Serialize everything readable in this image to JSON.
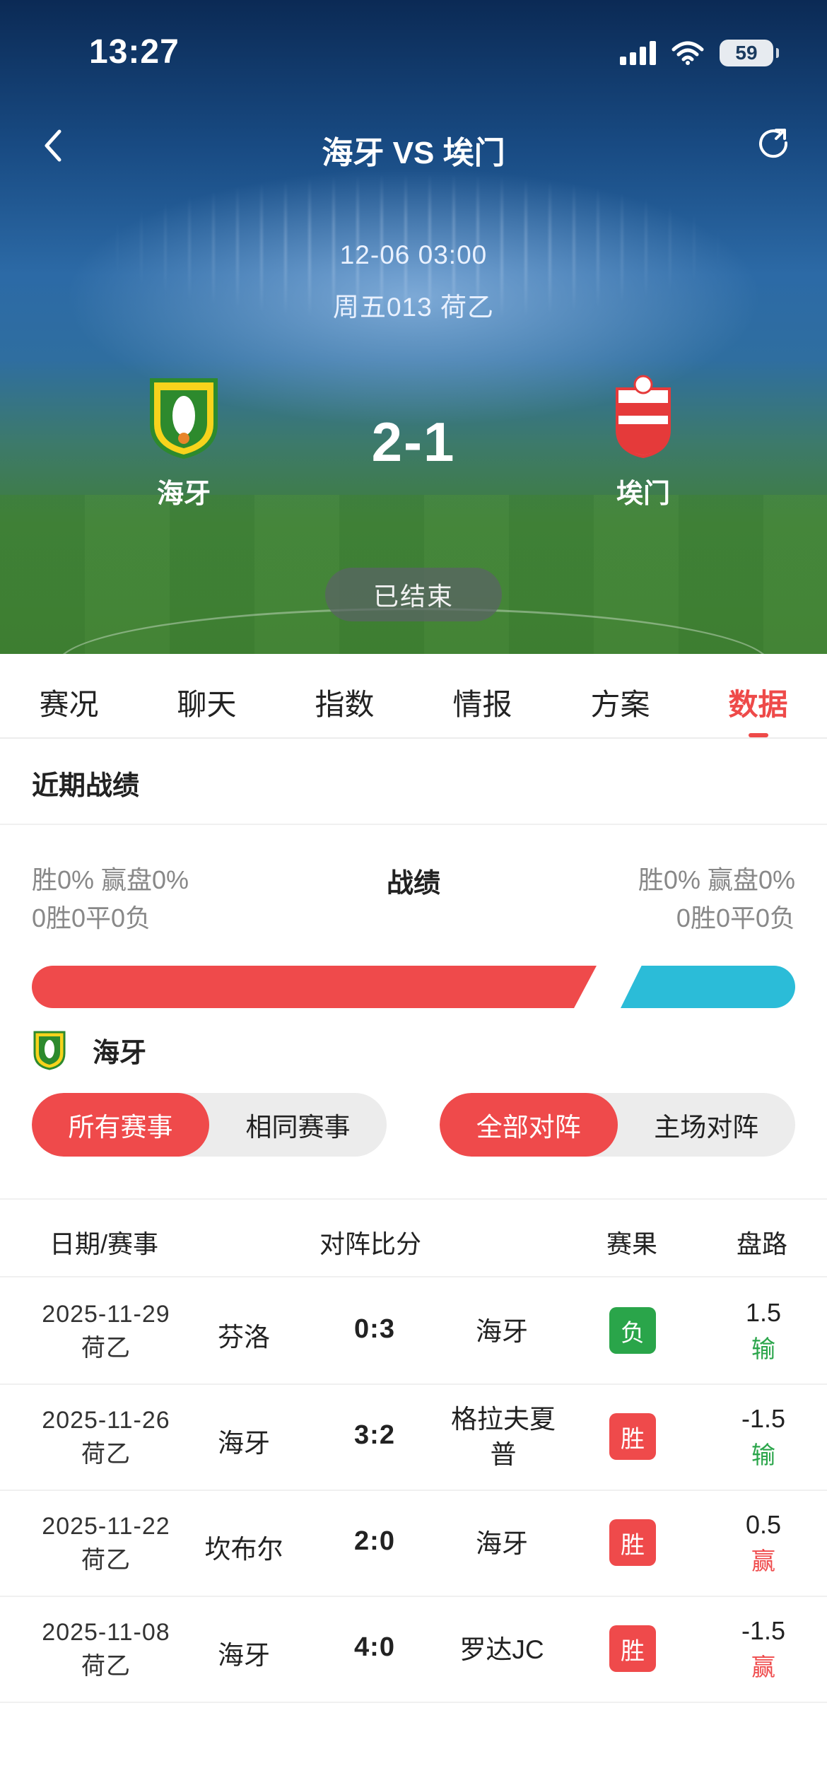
{
  "status": {
    "time": "13:27",
    "battery": "59"
  },
  "nav": {
    "title": "海牙 VS 埃门"
  },
  "match": {
    "datetime": "12-06 03:00",
    "league_line": "周五013 荷乙",
    "home_team": "海牙",
    "away_team": "埃门",
    "score": "2-1",
    "state": "已结束"
  },
  "tabs": [
    "赛况",
    "聊天",
    "指数",
    "情报",
    "方案",
    "数据"
  ],
  "active_tab": "数据",
  "recent": {
    "title": "近期战绩",
    "left_line1": "胜0% 赢盘0%",
    "left_line2": "0胜0平0负",
    "center": "战绩",
    "right_line1": "胜0% 赢盘0%",
    "right_line2": "0胜0平0负",
    "home_share": 0.74,
    "colors": {
      "home": "#ef4a4b",
      "away": "#2bbcd8"
    },
    "team_label": "海牙",
    "filter_left": [
      "所有赛事",
      "相同赛事"
    ],
    "filter_right": [
      "全部对阵",
      "主场对阵"
    ]
  },
  "table": {
    "headers": [
      "日期/赛事",
      "对阵比分",
      "赛果",
      "盘路"
    ],
    "rows": [
      {
        "date": "2025-11-29",
        "league": "荷乙",
        "home": "芬洛",
        "score": "0:3",
        "away": "海牙",
        "result": "负",
        "line": "1.5",
        "line_result": "输"
      },
      {
        "date": "2025-11-26",
        "league": "荷乙",
        "home": "海牙",
        "score": "3:2",
        "away": "格拉夫夏普",
        "result": "胜",
        "line": "-1.5",
        "line_result": "输"
      },
      {
        "date": "2025-11-22",
        "league": "荷乙",
        "home": "坎布尔",
        "score": "2:0",
        "away": "海牙",
        "result": "胜",
        "line": "0.5",
        "line_result": "赢"
      },
      {
        "date": "2025-11-08",
        "league": "荷乙",
        "home": "海牙",
        "score": "4:0",
        "away": "罗达JC",
        "result": "胜",
        "line": "-1.5",
        "line_result": "赢"
      }
    ]
  }
}
